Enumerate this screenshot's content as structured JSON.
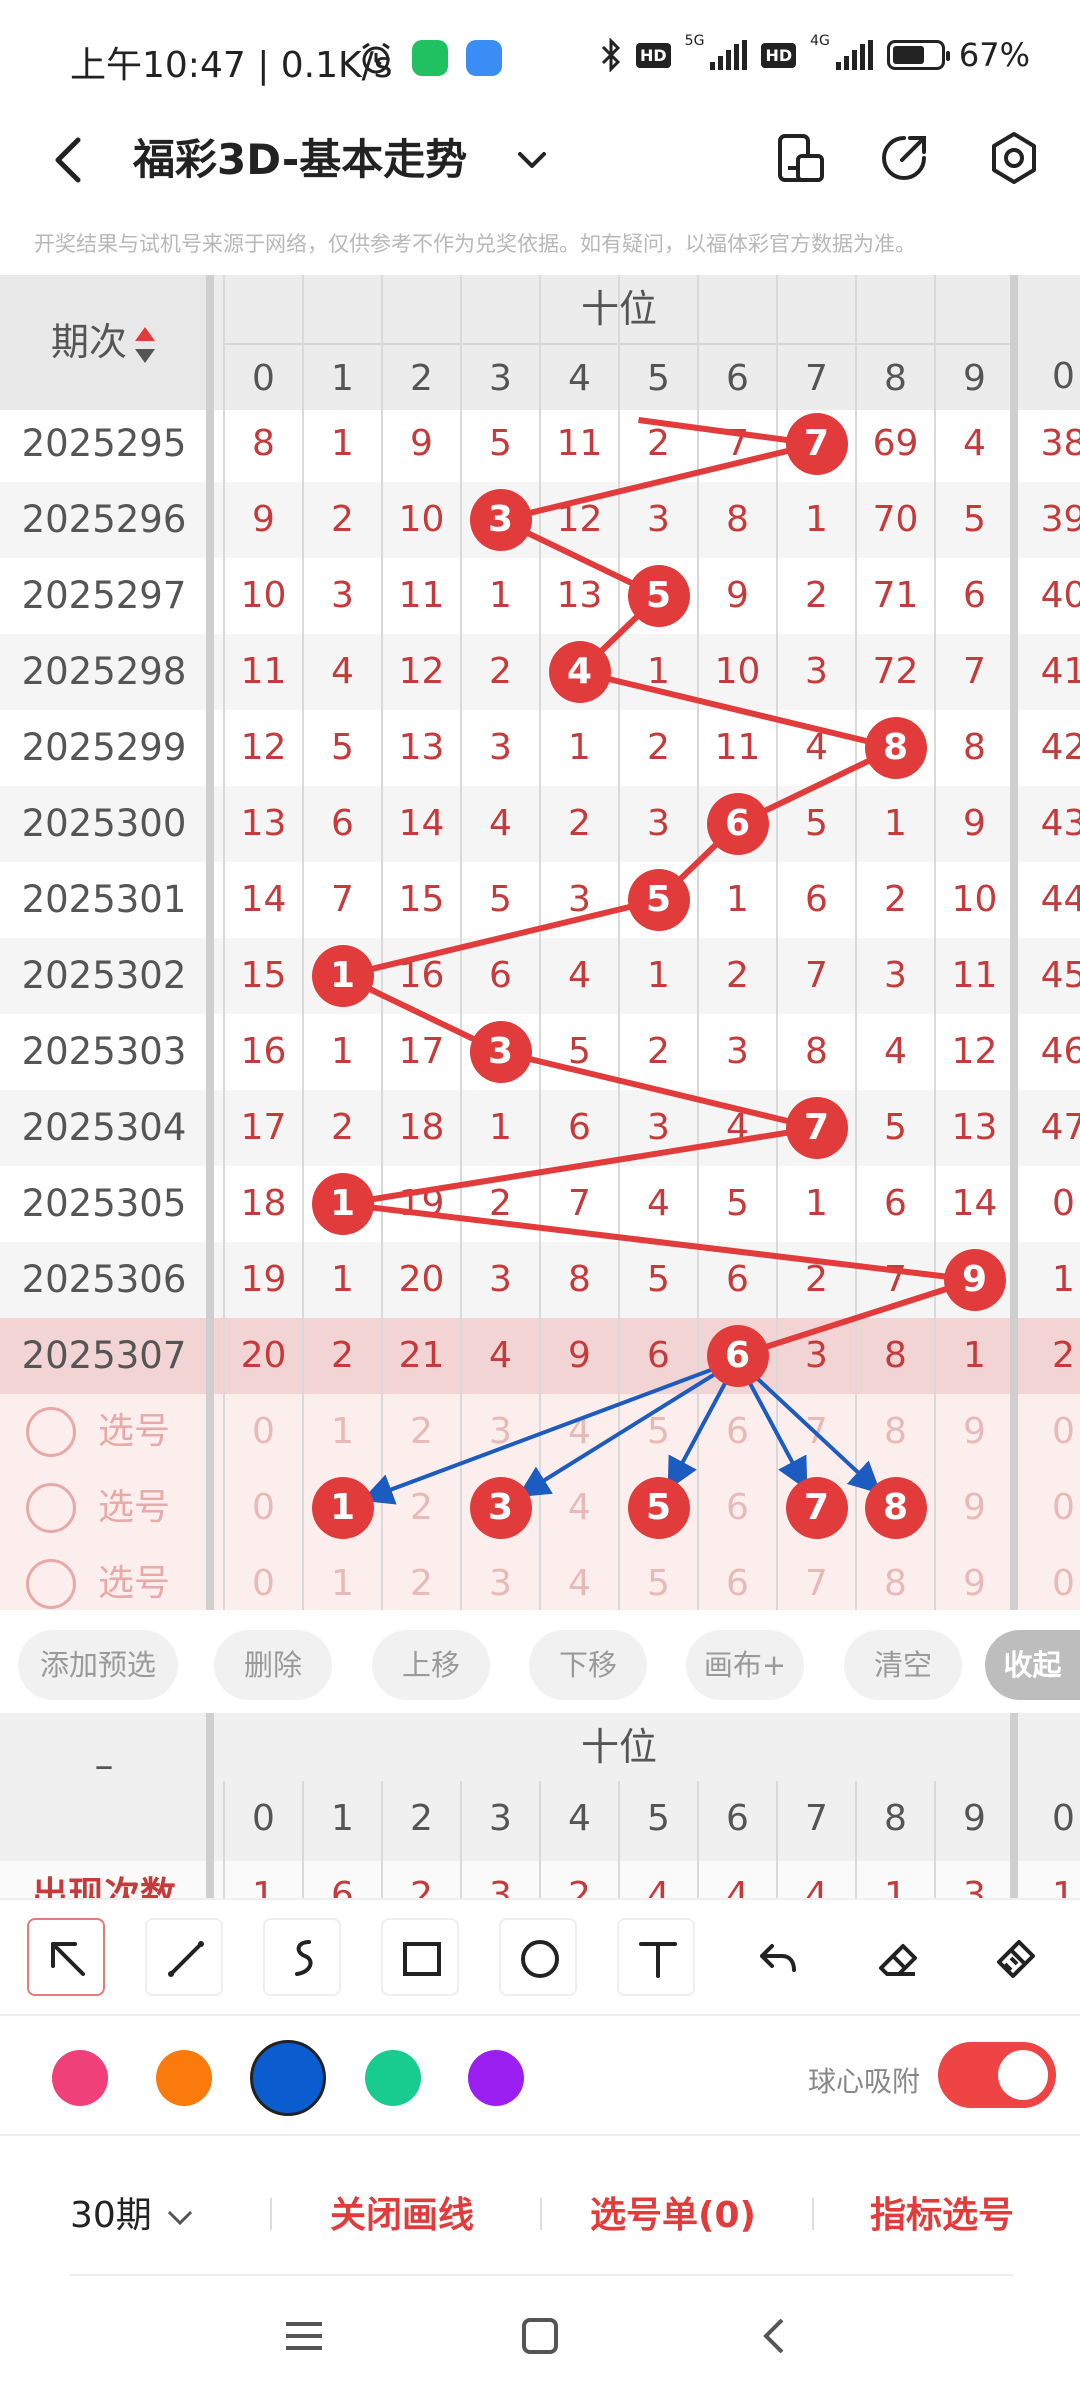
{
  "status_bar": {
    "time": "上午10:47 | 0.1K/s",
    "net1": "5G",
    "net2": "4G",
    "hd1": "HD",
    "hd2": "HD",
    "battery": "67%"
  },
  "header": {
    "title": "福彩3D-基本走势",
    "icons": [
      "back-icon",
      "chevron-down-icon",
      "portrait-icon",
      "share-icon",
      "settings-icon"
    ]
  },
  "disclaimer": "开奖结果与试机号来源于网络，仅供参考不作为兑奖依据。如有疑问，以福体彩官方数据为准。",
  "table": {
    "issue_header": "期次",
    "group_header": "十位",
    "digits": [
      "0",
      "1",
      "2",
      "3",
      "4",
      "5",
      "6",
      "7",
      "8",
      "9"
    ],
    "next_group_first": "0",
    "rows": [
      {
        "issue": "2025295",
        "cells": [
          "8",
          "1",
          "9",
          "5",
          "11",
          "2",
          "7",
          "7",
          "69",
          "4"
        ],
        "ball": 7,
        "next": "38"
      },
      {
        "issue": "2025296",
        "cells": [
          "9",
          "2",
          "10",
          "3",
          "12",
          "3",
          "8",
          "1",
          "70",
          "5"
        ],
        "ball": 3,
        "next": "39"
      },
      {
        "issue": "2025297",
        "cells": [
          "10",
          "3",
          "11",
          "1",
          "13",
          "5",
          "9",
          "2",
          "71",
          "6"
        ],
        "ball": 5,
        "next": "40"
      },
      {
        "issue": "2025298",
        "cells": [
          "11",
          "4",
          "12",
          "2",
          "4",
          "1",
          "10",
          "3",
          "72",
          "7"
        ],
        "ball": 4,
        "next": "41"
      },
      {
        "issue": "2025299",
        "cells": [
          "12",
          "5",
          "13",
          "3",
          "1",
          "2",
          "11",
          "4",
          "8",
          "8"
        ],
        "ball": 8,
        "next": "42"
      },
      {
        "issue": "2025300",
        "cells": [
          "13",
          "6",
          "14",
          "4",
          "2",
          "3",
          "6",
          "5",
          "1",
          "9"
        ],
        "ball": 6,
        "next": "43"
      },
      {
        "issue": "2025301",
        "cells": [
          "14",
          "7",
          "15",
          "5",
          "3",
          "5",
          "1",
          "6",
          "2",
          "10"
        ],
        "ball": 5,
        "next": "44"
      },
      {
        "issue": "2025302",
        "cells": [
          "15",
          "1",
          "16",
          "6",
          "4",
          "1",
          "2",
          "7",
          "3",
          "11"
        ],
        "ball": 1,
        "next": "45"
      },
      {
        "issue": "2025303",
        "cells": [
          "16",
          "1",
          "17",
          "3",
          "5",
          "2",
          "3",
          "8",
          "4",
          "12"
        ],
        "ball": 3,
        "next": "46"
      },
      {
        "issue": "2025304",
        "cells": [
          "17",
          "2",
          "18",
          "1",
          "6",
          "3",
          "4",
          "7",
          "5",
          "13"
        ],
        "ball": 7,
        "next": "47"
      },
      {
        "issue": "2025305",
        "cells": [
          "18",
          "1",
          "19",
          "2",
          "7",
          "4",
          "5",
          "1",
          "6",
          "14"
        ],
        "ball": 1,
        "next": "0"
      },
      {
        "issue": "2025306",
        "cells": [
          "19",
          "1",
          "20",
          "3",
          "8",
          "5",
          "6",
          "2",
          "7",
          "9"
        ],
        "ball": 9,
        "next": "1"
      },
      {
        "issue": "2025307",
        "cells": [
          "20",
          "2",
          "21",
          "4",
          "9",
          "6",
          "6",
          "3",
          "8",
          "1"
        ],
        "ball": 6,
        "next": "2"
      }
    ],
    "pick_label": "选号",
    "pick_rows": [
      {
        "balls": [],
        "next": "0"
      },
      {
        "balls": [
          1,
          3,
          5,
          7,
          8
        ],
        "next": "0"
      },
      {
        "balls": [],
        "next": "0"
      }
    ]
  },
  "actions": [
    "添加预选",
    "删除",
    "上移",
    "下移",
    "画布+",
    "清空"
  ],
  "collapse_label": "收起",
  "stats": {
    "dash": "–",
    "group_header": "十位",
    "digits": [
      "0",
      "1",
      "2",
      "3",
      "4",
      "5",
      "6",
      "7",
      "8",
      "9"
    ],
    "next_group_first": "0",
    "row_label": "出现次数",
    "counts": [
      "1",
      "6",
      "2",
      "3",
      "2",
      "4",
      "4",
      "4",
      "1",
      "3"
    ],
    "next_count": "1"
  },
  "tools": [
    "cursor-arrow-icon",
    "line-icon",
    "freehand-icon",
    "rectangle-icon",
    "circle-icon",
    "text-icon",
    "undo-icon",
    "eraser-icon",
    "clear-all-icon"
  ],
  "colors": {
    "pink": "#f0407a",
    "orange": "#fb7a0e",
    "blue": "#0a5ccf",
    "green": "#17cc8e",
    "purple": "#9b1ff0",
    "accent_red": "#e23b3b",
    "arrow_blue": "#1c5bbf"
  },
  "snap_label": "球心吸附",
  "snap_on": true,
  "bottom": {
    "period": "30期",
    "close_lines": "关闭画线",
    "pick_list": "选号单(0)",
    "indicator": "指标选号"
  }
}
